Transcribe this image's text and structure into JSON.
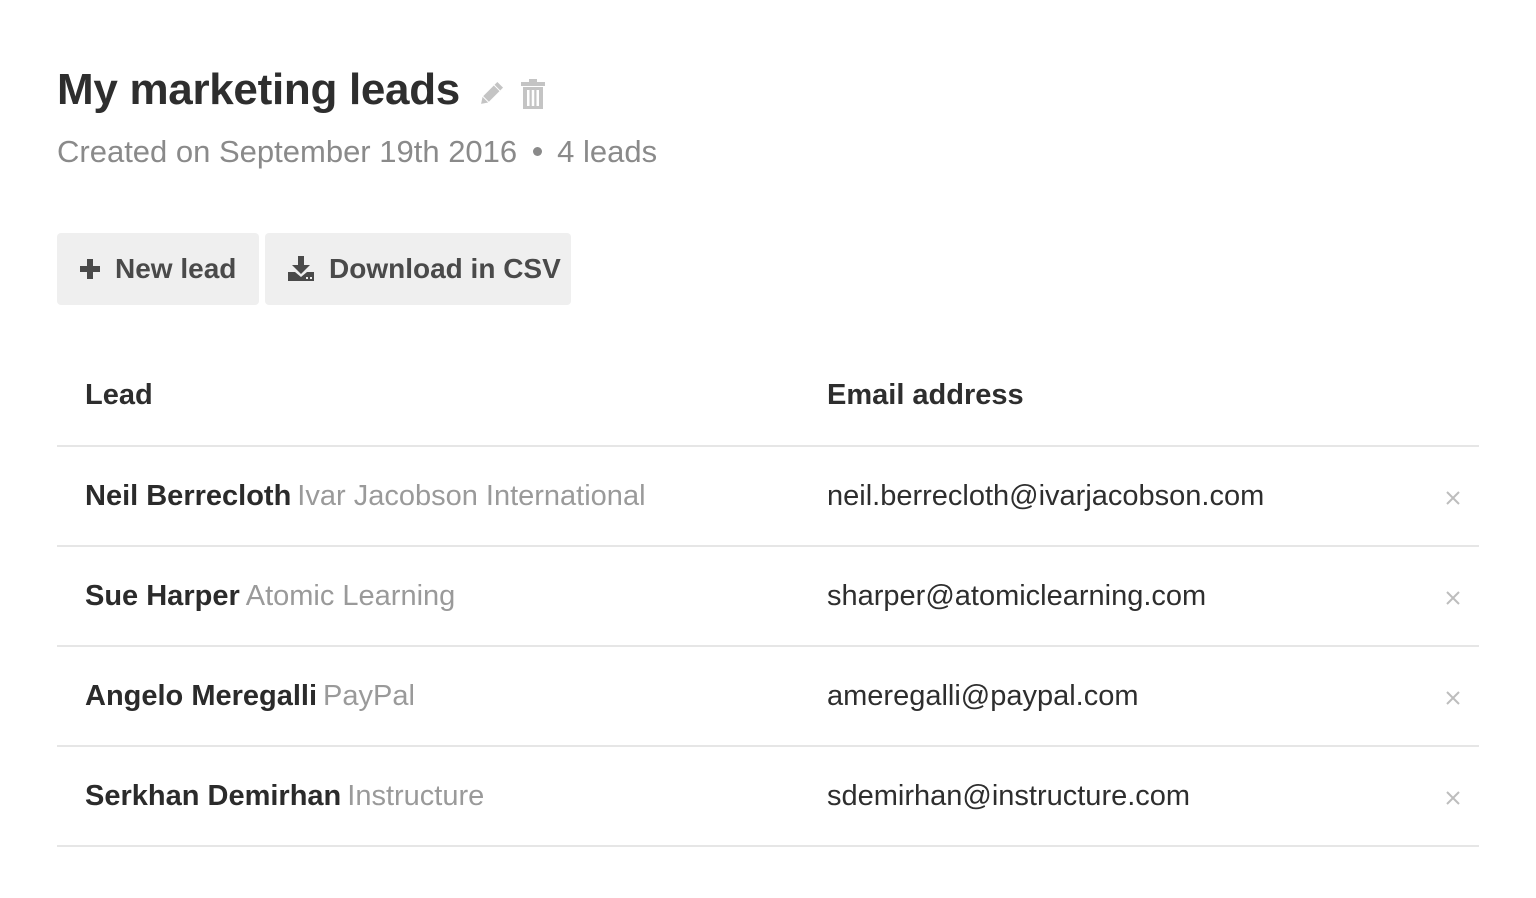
{
  "header": {
    "title": "My marketing leads",
    "icons": [
      "pencil-icon",
      "trash-icon"
    ],
    "created_text": "Created on September 19th 2016",
    "lead_count_text": "4 leads"
  },
  "toolbar": {
    "new_lead_label": "New lead",
    "new_lead_icon": "plus-icon",
    "download_csv_label": "Download in CSV",
    "download_csv_icon": "download-icon"
  },
  "table": {
    "columns": [
      "Lead",
      "Email address"
    ],
    "rows": [
      {
        "name": "Neil Berrecloth",
        "company": "Ivar Jacobson International",
        "email": "neil.berrecloth@ivarjacobson.com"
      },
      {
        "name": "Sue Harper",
        "company": "Atomic Learning",
        "email": "sharper@atomiclearning.com"
      },
      {
        "name": "Angelo Meregalli",
        "company": "PayPal",
        "email": "ameregalli@paypal.com"
      },
      {
        "name": "Serkhan Demirhan",
        "company": "Instructure",
        "email": "sdemirhan@instructure.com"
      }
    ],
    "row_action_icon": "close-icon"
  },
  "colors": {
    "title": "#2e2e2e",
    "muted_text": "#8a8a8a",
    "company_text": "#9a9a9a",
    "button_bg": "#efefef",
    "divider": "#e6e6e6",
    "icon_gray": "#c4c4c4"
  }
}
